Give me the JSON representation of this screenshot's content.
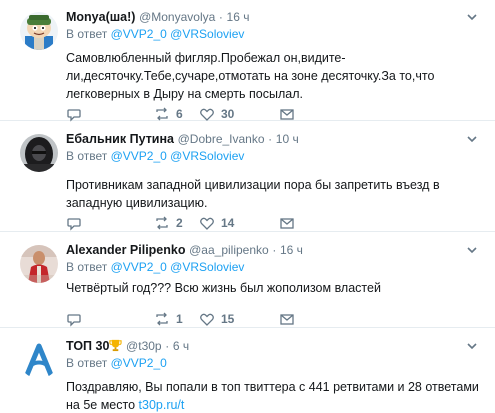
{
  "tweets": [
    {
      "fullname": "Monya(ша!)",
      "handle": "@Monyavolya",
      "dot": "·",
      "time": "16 ч",
      "replying_prefix": "В ответ",
      "mentions": [
        "@VVP2_0",
        "@VRSoloviev"
      ],
      "text": "Самовлюбленный фигляр.Пробежал он,видите-ли,десяточку.Тебе,сучаре,отмотать на зоне десяточку.За то,что легковерных в Дыру на смерть посылал.",
      "link": "",
      "replies": "",
      "retweets": "6",
      "likes": "30",
      "avatar_icon": "cartoon-avatar"
    },
    {
      "fullname": "Ебальник Путина",
      "handle": "@Dobre_Ivanko",
      "dot": "·",
      "time": "10 ч",
      "replying_prefix": "В ответ",
      "mentions": [
        "@VVP2_0",
        "@VRSoloviev"
      ],
      "text": "Противникам западной цивилизации пора бы запретить въезд в западную цивилизацию.",
      "link": "",
      "replies": "",
      "retweets": "2",
      "likes": "14",
      "avatar_icon": "dark-hood-avatar"
    },
    {
      "fullname": "Alexander Pilipenko",
      "handle": "@aa_pilipenko",
      "dot": "·",
      "time": "16 ч",
      "replying_prefix": "В ответ",
      "mentions": [
        "@VVP2_0",
        "@VRSoloviev"
      ],
      "text": "Четвёртый год??? Всю жизнь был жополизом властей",
      "link": "",
      "replies": "",
      "retweets": "1",
      "likes": "15",
      "avatar_icon": "red-figure-avatar"
    },
    {
      "fullname": "ТОП 30",
      "handle": "@t30p",
      "dot": "·",
      "time": "6 ч",
      "replying_prefix": "В ответ",
      "mentions": [
        "@VVP2_0"
      ],
      "text": "Поздравляю, Вы попали в топ твиттера с 441 ретвитами и 28 ответами на 5е место ",
      "link": "t30p.ru/t",
      "replies": "",
      "retweets": "",
      "likes": "",
      "avatar_icon": "letter-a-avatar"
    }
  ],
  "colors": {
    "link": "#1da1f2",
    "muted": "#657786",
    "text": "#14171a",
    "divider": "#e6ecf0"
  }
}
